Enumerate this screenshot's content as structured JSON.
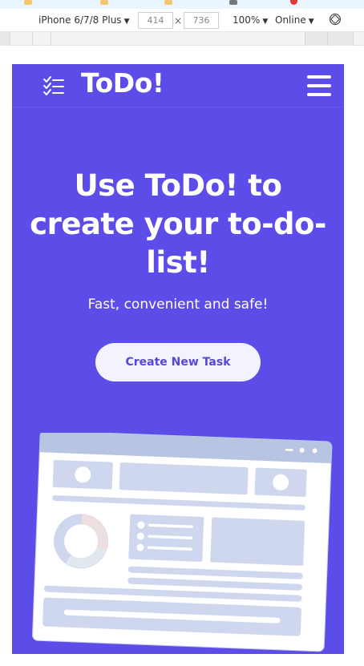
{
  "devtools": {
    "device": "iPhone 6/7/8 Plus",
    "width_value": "414",
    "height_value": "736",
    "times": "×",
    "zoom": "100%",
    "network": "Online",
    "caret": "▼"
  },
  "app": {
    "brand": "ToDo!",
    "hero_title": "Use ToDo! to create your to-do-list!",
    "hero_subtitle": "Fast, convenient and safe!",
    "cta_label": "Create New Task"
  },
  "colors": {
    "primary": "#5d4de8",
    "button_bg": "#f2f3fd",
    "button_text": "#5746d6",
    "illustration_fill": "#ced7ee",
    "illustration_header": "#b7c4e2"
  },
  "icons": {
    "logo": "checklist-icon",
    "menu": "hamburger-menu-icon",
    "rotate": "rotate-icon"
  }
}
